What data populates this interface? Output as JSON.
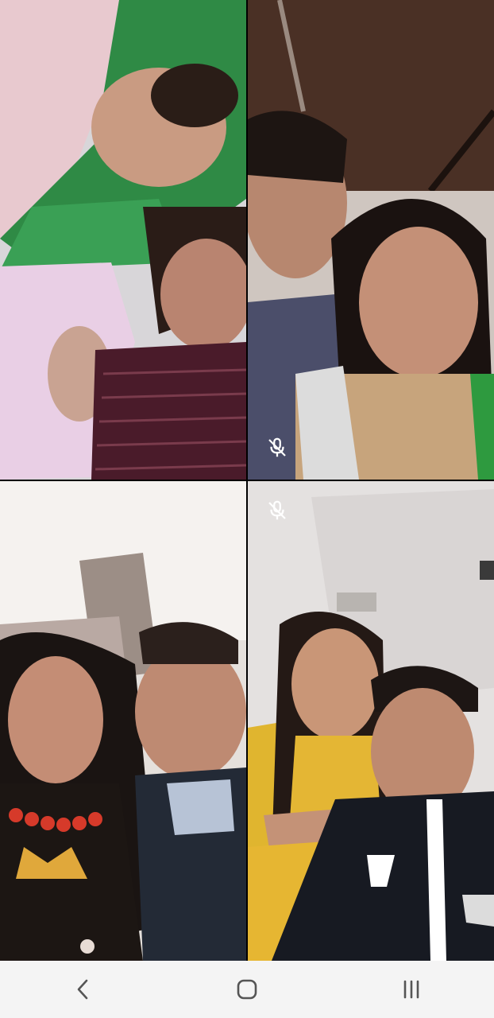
{
  "participants": [
    {
      "id": "p1",
      "muted": false
    },
    {
      "id": "p2",
      "muted": true
    },
    {
      "id": "p3",
      "muted": false
    },
    {
      "id": "p4",
      "muted": true
    }
  ],
  "icons": {
    "mute": "mic-off-icon",
    "back": "back-icon",
    "home": "home-icon",
    "recents": "recents-icon"
  },
  "colors": {
    "navbar_bg": "#f4f4f4",
    "nav_icon": "#555555",
    "mute_icon": "#ffffff"
  }
}
